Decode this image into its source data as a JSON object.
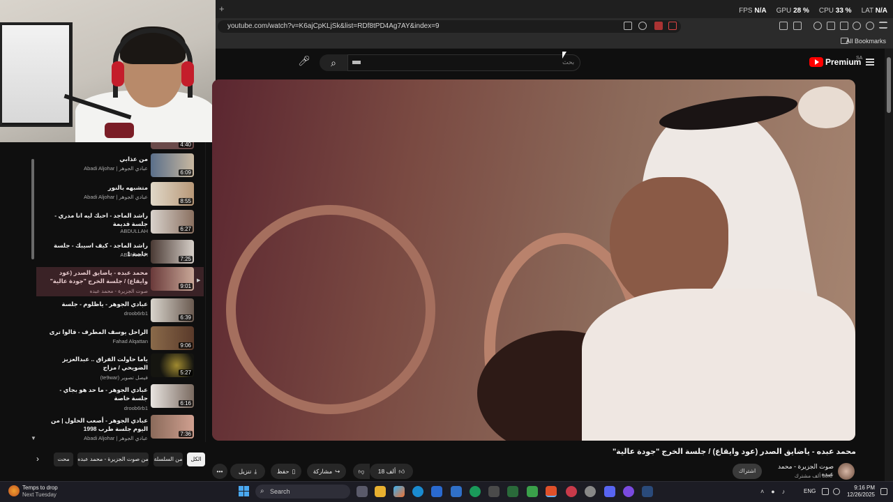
{
  "browser": {
    "url": "youtube.com/watch?v=K6ajCpKLjSk&list=RDf8tPD4Ag7AY&index=9",
    "new_tab": "+",
    "all_bookmarks": "All Bookmarks",
    "stats": {
      "fps_label": "FPS",
      "fps_value": "N/A",
      "gpu_label": "GPU",
      "gpu_value": "28 %",
      "cpu_label": "CPU",
      "cpu_value": "33 %",
      "lat_label": "LAT",
      "lat_value": "N/A"
    }
  },
  "youtube": {
    "search_placeholder": "بحث",
    "logo_text": "Premium",
    "country": "SA"
  },
  "playlist": {
    "items": [
      {
        "title": "",
        "channel": "",
        "duration": "4:40",
        "active": false
      },
      {
        "title": "من عذابي",
        "channel": "Abadi Aljohar | عبادي الجوهر",
        "duration": "6:09",
        "active": false
      },
      {
        "title": "متشبهه بالنور",
        "channel": "Abadi Aljohar | عبادي الجوهر",
        "duration": "8:55",
        "active": false
      },
      {
        "title": "راشد الماجد - احبك ليه انا مدري - جلسة قديمة",
        "channel": "ABDULLAH",
        "duration": "6:27",
        "active": false
      },
      {
        "title": "راشد الماجد - كيف اسيبك - جلسة خاصة 1",
        "channel": "ABDULLAH",
        "duration": "7:25",
        "active": false
      },
      {
        "title": "محمد عبده - ياضايق الصدر (عود وايقاع) / جلسة الخرج \"جودة عالية\"",
        "channel": "صوت الجزيرة - محمد عبده",
        "duration": "9:01",
        "active": true
      },
      {
        "title": "عبادي الجوهر - ياظلوم - جلسة",
        "channel": "droob6rb1",
        "duration": "6:39",
        "active": false
      },
      {
        "title": "الراحل يوسف المطرف - قالوا ترى",
        "channel": "Fahad Alqattan",
        "duration": "9:06",
        "active": false
      },
      {
        "title": "ياما حاولت الفراق .. عبدالعزيز الضويحي / مزاج",
        "channel": "(te9war) فيصل تصوير",
        "duration": "5:27",
        "active": false
      },
      {
        "title": "عبادي الجوهر - ما حد هو بجاي - جلسة خاصة",
        "channel": "droob6rb1",
        "duration": "6:16",
        "active": false
      },
      {
        "title": "عبادي الجوهر - أصعب الحلول | من اليوم جلسة طرب 1998",
        "channel": "Abadi Aljohar | عبادي الجوهر",
        "duration": "7:36",
        "active": false
      }
    ],
    "play_marker": "▶",
    "scroll_down": "▼"
  },
  "chips": {
    "all": "الكل",
    "series": "من السلسلة",
    "channel": "من صوت الجزيرة - محمد عبده",
    "related": "محت",
    "next": "›"
  },
  "video": {
    "title": "محمد عبده - ياضايق الصدر (عود وايقاع) / جلسة الخرج \"جودة عالية\"",
    "channel": "صوت الجزيرة - محمد عبده",
    "subscribers": "38.6 ألف مشترك",
    "subscribe": "اشتراك",
    "likes": "18 ألف",
    "share": "مشاركة",
    "save": "حفظ",
    "download": "تنزيل",
    "more": "•••"
  },
  "taskbar": {
    "weather_line1": "Temps to drop",
    "weather_line2": "Next Tuesday",
    "search_label": "Search",
    "language": "ENG",
    "time": "9:16 PM",
    "date": "12/26/2025"
  }
}
